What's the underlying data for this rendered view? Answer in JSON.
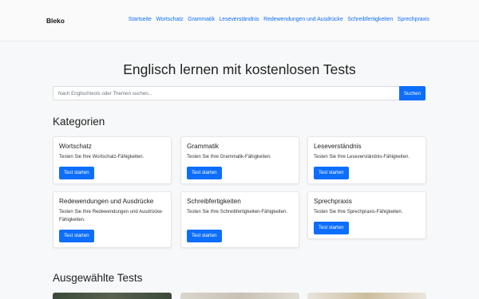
{
  "brand": "Bleko",
  "nav": [
    "Startseite",
    "Wortschatz",
    "Grammatik",
    "Leseverständnis",
    "Redewendungen und Ausdrücke",
    "Schreibfertigkeiten",
    "Sprechpraxis"
  ],
  "hero": {
    "title": "Englisch lernen mit kostenlosen Tests"
  },
  "search": {
    "placeholder": "Nach Englischtests oder Themen suchen...",
    "value": "",
    "button": "Suchen"
  },
  "categories": {
    "title": "Kategorien",
    "items": [
      {
        "title": "Wortschatz",
        "text": "Testen Sie Ihre Wortschatz-Fähigkeiten.",
        "button": "Test starten"
      },
      {
        "title": "Grammatik",
        "text": "Testen Sie Ihre Grammatik-Fähigkeiten.",
        "button": "Test starten"
      },
      {
        "title": "Leseverständnis",
        "text": "Testen Sie Ihre Leseverständnis-Fähigkeiten.",
        "button": "Test starten"
      },
      {
        "title": "Redewendungen und Ausdrücke",
        "text": "Testen Sie Ihre Redewendungen und Ausdrücke-Fähigkeiten.",
        "button": "Test starten"
      },
      {
        "title": "Schreibfertigkeiten",
        "text": "Testen Sie Ihre Schreibfertigkeiten-Fähigkeiten.",
        "button": "Test starten"
      },
      {
        "title": "Sprechpraxis",
        "text": "Testen Sie Ihre Sprechpraxis-Fähigkeiten.",
        "button": "Test starten"
      }
    ]
  },
  "featured": {
    "title": "Ausgewählte Tests"
  },
  "colors": {
    "accent": "#0d6efd",
    "background": "#f7f8f9",
    "card": "#ffffff"
  }
}
